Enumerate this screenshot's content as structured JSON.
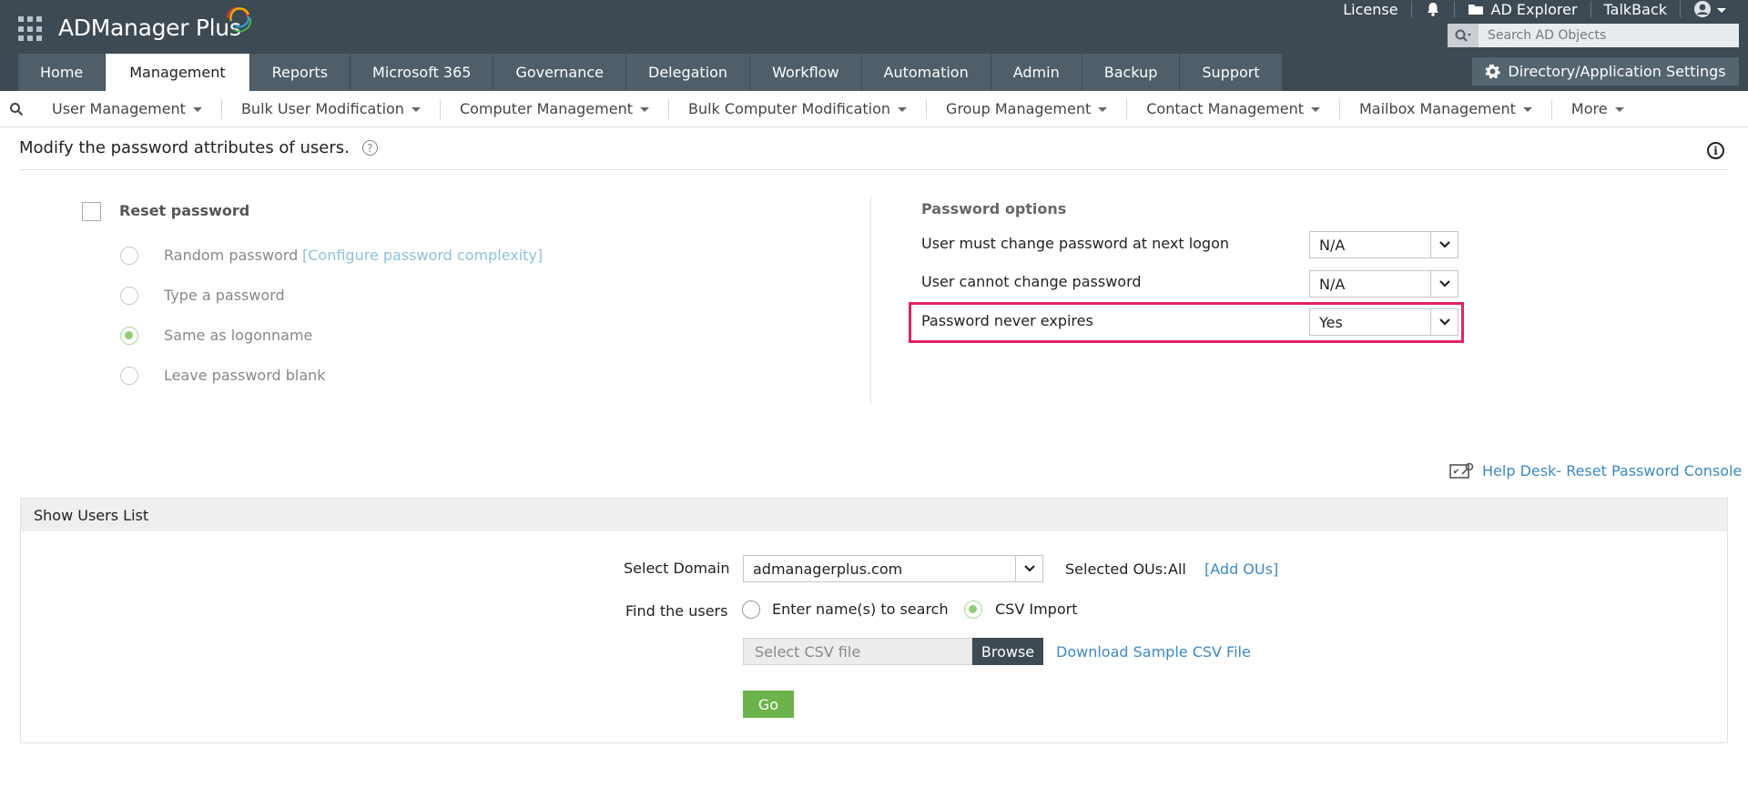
{
  "header": {
    "logo_text": "ADManager Plus",
    "top_links": [
      "License",
      "AD Explorer",
      "TalkBack"
    ],
    "search_placeholder": "Search AD Objects",
    "tabs": [
      "Home",
      "Management",
      "Reports",
      "Microsoft 365",
      "Governance",
      "Delegation",
      "Workflow",
      "Automation",
      "Admin",
      "Backup",
      "Support"
    ],
    "active_tab": "Management",
    "settings_button": "Directory/Application Settings"
  },
  "subnav": {
    "items": [
      "User Management",
      "Bulk User Modification",
      "Computer Management",
      "Bulk Computer Modification",
      "Group Management",
      "Contact Management",
      "Mailbox Management",
      "More"
    ]
  },
  "page": {
    "title": "Modify the password attributes of users."
  },
  "reset": {
    "label": "Reset password",
    "checked": false,
    "options": [
      "Random password",
      "Type a password",
      "Same as logonname",
      "Leave password blank"
    ],
    "selected": "Same as logonname",
    "config_link": "[Configure password complexity]"
  },
  "password_options": {
    "heading": "Password options",
    "rows": [
      {
        "label": "User must change password at next logon",
        "value": "N/A"
      },
      {
        "label": "User cannot change password",
        "value": "N/A"
      },
      {
        "label": "Password never expires",
        "value": "Yes"
      }
    ]
  },
  "helpdesk_link": "Help Desk- Reset Password Console",
  "users_panel": {
    "heading": "Show Users List",
    "domain_label": "Select Domain",
    "domain_value": "admanagerplus.com",
    "selected_ous_label": "Selected OUs:",
    "selected_ous_value": "All",
    "add_ous_link": "[Add OUs]",
    "find_label": "Find the users",
    "find_options": [
      "Enter name(s) to search",
      "CSV Import"
    ],
    "find_selected": "CSV Import",
    "csv_placeholder": "Select CSV file",
    "browse_label": "Browse",
    "sample_link": "Download Sample CSV File",
    "go_label": "Go"
  },
  "colors": {
    "header_bg": "#3d4a53",
    "tab_bg": "#4f5e68",
    "accent_link": "#3c8ac4",
    "highlight": "#e0245e",
    "go_green": "#6bb34a"
  }
}
